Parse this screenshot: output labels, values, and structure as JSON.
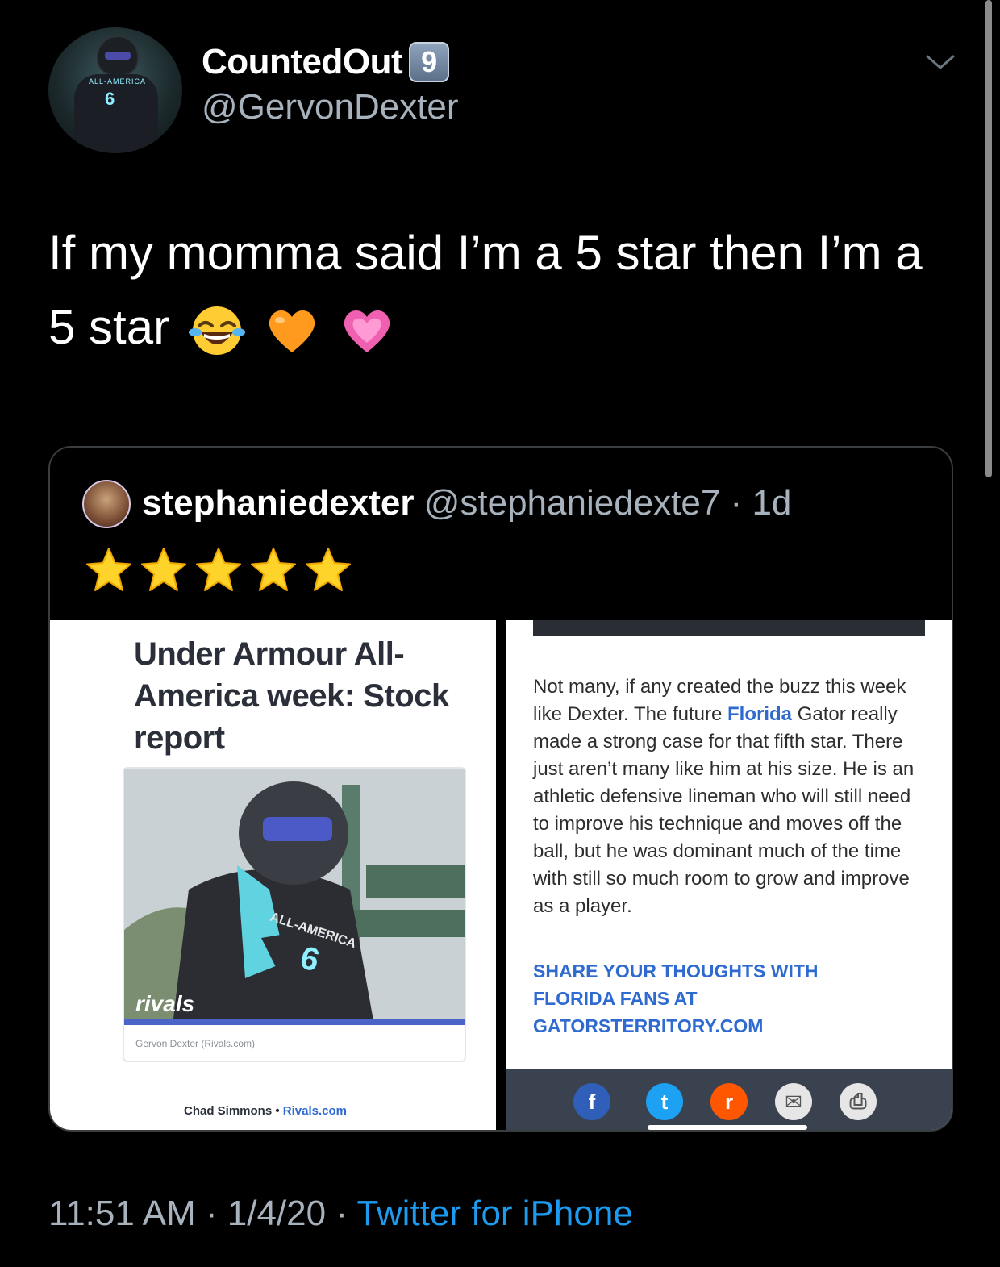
{
  "author": {
    "display_name": "CountedOut",
    "badge": "9",
    "handle": "@GervonDexter",
    "avatar_jersey_text": "ALL-AMERICA",
    "avatar_jersey_number": "6"
  },
  "tweet": {
    "text": "If my momma said I’m a 5 star then I’m a 5 star",
    "emojis": [
      "laughing-tears-emoji",
      "orange-heart-emoji",
      "pink-heart-emoji"
    ]
  },
  "quoted": {
    "display_name": "stephaniedexter",
    "handle": "@stephaniedexte7",
    "separator": "·",
    "age": "1d",
    "stars": 5,
    "left_image": {
      "title": "Under Armour All-America week: Stock report",
      "photo_text": "ALL-AMERICA",
      "photo_number": "6",
      "logo": "rivals",
      "caption": "Gervon Dexter (Rivals.com)",
      "byline_name": "Chad Simmons",
      "byline_sep": "•",
      "byline_site": "Rivals.com"
    },
    "right_image": {
      "body_pre": "Not many, if any created the buzz this week like Dexter. The future ",
      "body_link": "Florida",
      "body_post": " Gator really made a strong case for that fifth star. There just aren’t many like him at his size. He is an athletic defensive lineman who will still need to improve his technique and moves off the ball, but he was dominant much of the time with still so much room to grow and improve as a player.",
      "cta": "SHARE YOUR THOUGHTS WITH FLORIDA FANS AT GATORSTERRITORY.COM",
      "share_icons": [
        {
          "name": "facebook-icon",
          "glyph": "f",
          "color": "#2f5fb8"
        },
        {
          "name": "twitter-icon",
          "glyph": "t",
          "color": "#1da1f2"
        },
        {
          "name": "reddit-icon",
          "glyph": "r",
          "color": "#ff5700"
        },
        {
          "name": "email-icon",
          "glyph": "✉",
          "color": "#e6e6e6"
        },
        {
          "name": "print-icon",
          "glyph": "⎙",
          "color": "#e6e6e6"
        }
      ]
    }
  },
  "footer": {
    "time": "11:51 AM",
    "sep1": "·",
    "date": "1/4/20",
    "sep2": "·",
    "source": "Twitter for iPhone"
  },
  "colors": {
    "background": "#000000",
    "secondary_text": "#a8b2bc",
    "link": "#1d9bf0",
    "card_border": "#3a3d40",
    "rivals_blue": "#2f6ad0"
  }
}
